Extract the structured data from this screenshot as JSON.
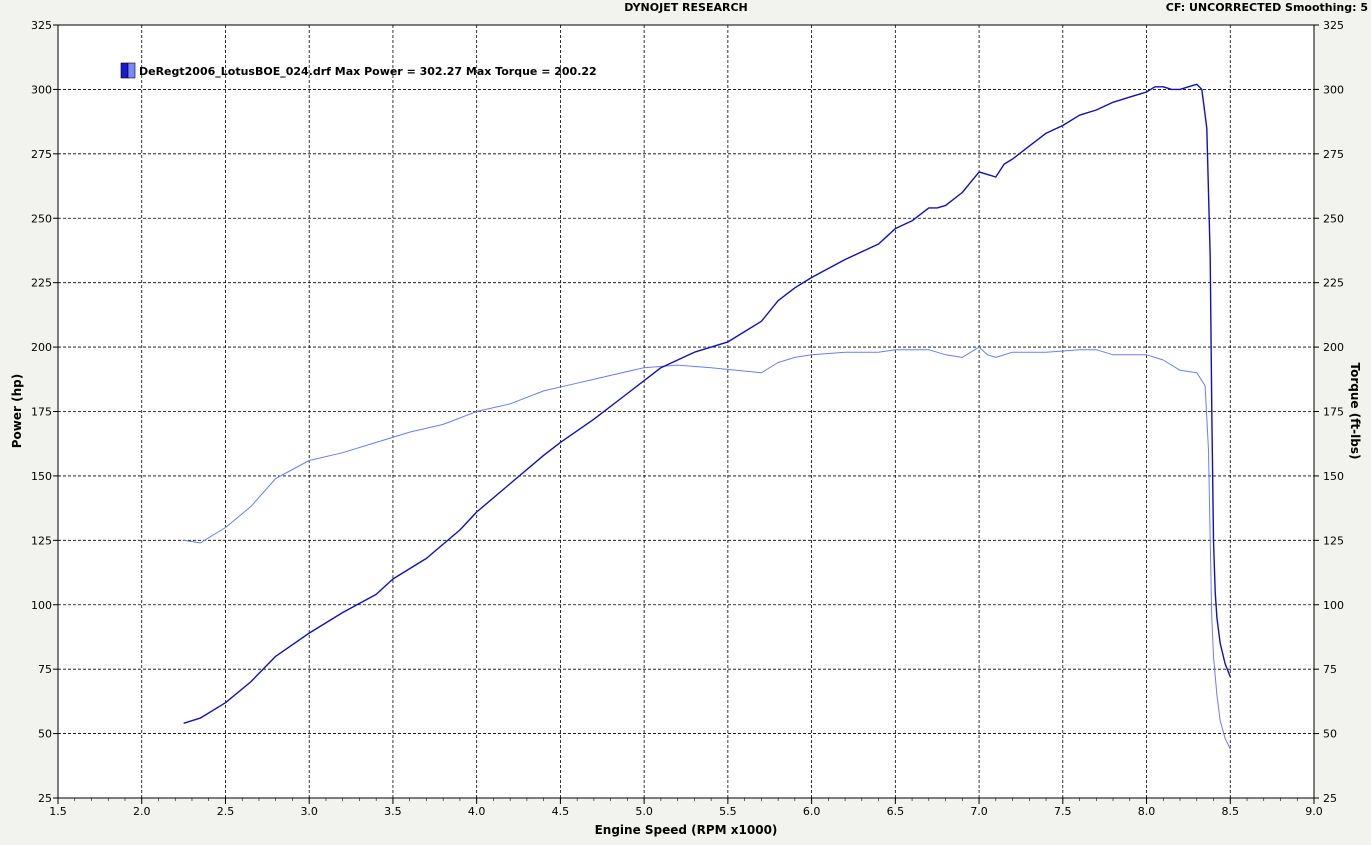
{
  "header": {
    "title": "DYNOJET RESEARCH",
    "right_text": "CF: UNCORRECTED  Smoothing: 5"
  },
  "legend": {
    "text": "DeRegt2006_LotusBOE_024.drf Max Power = 302.27 Max Torque = 200.22",
    "swatch_colors": [
      "#1a1ad0",
      "#7b86ff"
    ]
  },
  "chart_data": {
    "type": "line",
    "title": "DYNOJET RESEARCH",
    "xlabel": "Engine Speed (RPM x1000)",
    "ylabel": "Power (hp)",
    "y2label": "Torque (ft-lbs)",
    "xlim": [
      1.5,
      9.0
    ],
    "ylim": [
      25,
      325
    ],
    "y2lim": [
      25,
      325
    ],
    "x_ticks": [
      "1.5",
      "2.0",
      "2.5",
      "3.0",
      "3.5",
      "4.0",
      "4.5",
      "5.0",
      "5.5",
      "6.0",
      "6.5",
      "7.0",
      "7.5",
      "8.0",
      "8.5",
      "9.0"
    ],
    "y_ticks": [
      "325",
      "300",
      "275",
      "250",
      "225",
      "200",
      "175",
      "150",
      "125",
      "100",
      "75",
      "50",
      "25"
    ],
    "grid": true,
    "legend_position": "top-left",
    "series": [
      {
        "name": "Power",
        "axis": "left",
        "color": "#1010c0",
        "x": [
          2.25,
          2.35,
          2.5,
          2.65,
          2.8,
          3.0,
          3.2,
          3.4,
          3.5,
          3.7,
          3.9,
          4.0,
          4.2,
          4.4,
          4.5,
          4.7,
          4.9,
          5.1,
          5.3,
          5.5,
          5.6,
          5.7,
          5.8,
          5.9,
          6.0,
          6.2,
          6.4,
          6.5,
          6.6,
          6.7,
          6.75,
          6.8,
          6.9,
          6.95,
          7.0,
          7.05,
          7.1,
          7.15,
          7.2,
          7.3,
          7.4,
          7.5,
          7.6,
          7.7,
          7.8,
          7.9,
          8.0,
          8.05,
          8.1,
          8.15,
          8.2,
          8.25,
          8.3,
          8.33,
          8.36,
          8.38,
          8.39,
          8.4,
          8.41,
          8.42,
          8.44,
          8.47,
          8.5
        ],
        "values": [
          54,
          56,
          62,
          70,
          80,
          89,
          97,
          104,
          110,
          118,
          129,
          136,
          147,
          158,
          163,
          172,
          182,
          192,
          198,
          202,
          206,
          210,
          218,
          223,
          227,
          234,
          240,
          246,
          249,
          254,
          254,
          255,
          260,
          264,
          268,
          267,
          266,
          271,
          273,
          278,
          283,
          286,
          290,
          292,
          295,
          297,
          299,
          301,
          301,
          300,
          300,
          301,
          302,
          300,
          285,
          235,
          175,
          125,
          105,
          95,
          85,
          77,
          72
        ]
      },
      {
        "name": "Torque",
        "axis": "right",
        "color": "#6a7cff",
        "x": [
          2.25,
          2.35,
          2.5,
          2.65,
          2.8,
          3.0,
          3.2,
          3.4,
          3.6,
          3.8,
          4.0,
          4.2,
          4.4,
          4.6,
          4.8,
          5.0,
          5.2,
          5.4,
          5.55,
          5.7,
          5.8,
          5.9,
          6.0,
          6.2,
          6.4,
          6.5,
          6.6,
          6.7,
          6.8,
          6.9,
          7.0,
          7.05,
          7.1,
          7.2,
          7.4,
          7.6,
          7.7,
          7.8,
          8.0,
          8.1,
          8.2,
          8.3,
          8.35,
          8.37,
          8.38,
          8.39,
          8.4,
          8.42,
          8.44,
          8.47,
          8.5
        ],
        "values": [
          125,
          124,
          130,
          138,
          149,
          156,
          159,
          163,
          167,
          170,
          175,
          178,
          183,
          186,
          189,
          192,
          193,
          192,
          191,
          190,
          194,
          196,
          197,
          198,
          198,
          199,
          199,
          199,
          197,
          196,
          200,
          197,
          196,
          198,
          198,
          199,
          199,
          197,
          197,
          195,
          191,
          190,
          185,
          160,
          125,
          95,
          80,
          65,
          55,
          48,
          44
        ]
      }
    ]
  }
}
